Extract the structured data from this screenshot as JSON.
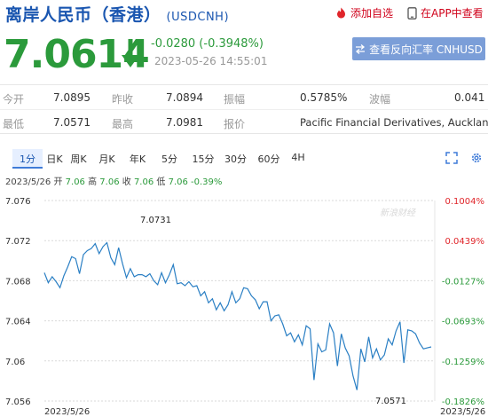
{
  "header": {
    "title": "离岸人民币（香港）",
    "symbol": "(USDCNH)",
    "add_watchlist": "添加自选",
    "app_view": "在APP中查看"
  },
  "quote": {
    "price": "7.0614",
    "change": "-0.0280 (-0.3948%)",
    "timestamp": "2023-05-26 14:55:01",
    "reverse_label": "查看反向汇率 CNHUSD"
  },
  "stats": {
    "row1": [
      {
        "label": "今开",
        "value": "7.0895"
      },
      {
        "label": "昨收",
        "value": "7.0894"
      },
      {
        "label": "振幅",
        "value": "0.5785%"
      },
      {
        "label": "波幅",
        "value": "0.041"
      }
    ],
    "row2": [
      {
        "label": "最低",
        "value": "7.0571"
      },
      {
        "label": "最高",
        "value": "7.0981"
      },
      {
        "label": "报价",
        "value": "Pacific Financial Derivatives, Auckland"
      }
    ]
  },
  "tabs": [
    "1分",
    "日K",
    "周K",
    "月K",
    "年K",
    "5分",
    "15分",
    "30分",
    "60分",
    "4H"
  ],
  "active_tab": 0,
  "info_line": {
    "date": "2023/5/26",
    "items": [
      {
        "label": "开",
        "value": "7.06"
      },
      {
        "label": "高",
        "value": "7.06"
      },
      {
        "label": "收",
        "value": "7.06"
      },
      {
        "label": "低",
        "value": "7.06"
      }
    ],
    "change": "-0.39%"
  },
  "colors": {
    "up": "#e0252a",
    "down": "#2b9a3b",
    "line": "#2a7fc4",
    "brand": "#1a56b0",
    "button": "#7b9ed8"
  },
  "icons": {
    "add_watchlist": "flame-icon",
    "app": "phone-icon",
    "reverse": "swap-icon",
    "fullscreen": "expand-icon",
    "settings": "gear-icon"
  },
  "chart_data": {
    "type": "line",
    "y_left_ticks": [
      "7.076",
      "7.072",
      "7.068",
      "7.064",
      "7.06",
      "7.056"
    ],
    "y_right_ticks": [
      "0.1004%",
      "0.0439%",
      "-0.0127%",
      "-0.0693%",
      "-0.1259%",
      "-0.1826%"
    ],
    "ylim": [
      7.056,
      7.076
    ],
    "x_labels": [
      "2023/5/26",
      "2023/5/26"
    ],
    "high_label": "7.0731",
    "low_label": "7.0571",
    "watermark": "新浪财经",
    "values": [
      7.0688,
      7.0678,
      7.0684,
      7.0679,
      7.0673,
      7.0685,
      7.0694,
      7.0704,
      7.0702,
      7.0687,
      7.0706,
      7.071,
      7.0712,
      7.0717,
      7.0707,
      7.0714,
      7.0718,
      7.0703,
      7.0696,
      7.0713,
      7.0697,
      7.0683,
      7.0692,
      7.0684,
      7.0686,
      7.0686,
      7.0684,
      7.0687,
      7.068,
      7.0676,
      7.0688,
      7.0678,
      7.0686,
      7.0696,
      7.0677,
      7.0678,
      7.0675,
      7.0679,
      7.0674,
      7.0675,
      7.0665,
      7.0669,
      7.0658,
      7.0662,
      7.0651,
      7.0658,
      7.065,
      7.0656,
      7.0669,
      7.0658,
      7.0662,
      7.0673,
      7.0672,
      7.0665,
      7.0661,
      7.0652,
      7.0659,
      7.0659,
      7.064,
      7.0645,
      7.0646,
      7.0637,
      7.0625,
      7.0628,
      7.0619,
      7.0626,
      7.0616,
      7.0635,
      7.0632,
      7.0581,
      7.0617,
      7.0609,
      7.0611,
      7.0637,
      7.0628,
      7.0595,
      7.0627,
      7.0613,
      7.0605,
      7.0585,
      7.0571,
      7.0612,
      7.0599,
      7.0624,
      7.0603,
      7.0612,
      7.0601,
      7.0606,
      7.0622,
      7.0616,
      7.063,
      7.0639,
      7.0598,
      7.0631,
      7.063,
      7.0627,
      7.0618,
      7.0612,
      7.0613,
      7.0614
    ]
  }
}
